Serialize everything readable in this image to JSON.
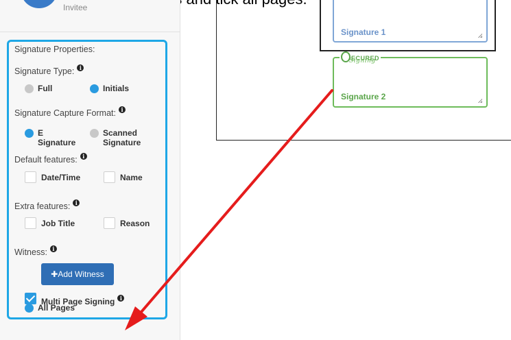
{
  "caption": "multipage signing all pages and tick all pages.",
  "sidebar": {
    "invitee_label": "Invitee",
    "panel": {
      "title": "Signature Properties:",
      "signature_type": {
        "label": "Signature Type:",
        "options": [
          {
            "label": "Full",
            "selected": false
          },
          {
            "label": "Initials",
            "selected": true
          }
        ]
      },
      "capture_format": {
        "label": "Signature Capture Format:",
        "options": [
          {
            "line1": "E",
            "line2": "Signature",
            "selected": true
          },
          {
            "line1": "Scanned",
            "line2": "Signature",
            "selected": false
          }
        ]
      },
      "default_features": {
        "label": "Default features:",
        "options": [
          {
            "label": "Date/Time",
            "checked": false
          },
          {
            "label": "Name",
            "checked": false
          }
        ]
      },
      "extra_features": {
        "label": "Extra features:",
        "options": [
          {
            "label": "Job Title",
            "checked": false
          },
          {
            "label": "Reason",
            "checked": false
          }
        ]
      },
      "witness": {
        "label": "Witness:",
        "button_label": "✚Add Witness"
      },
      "multi_page": {
        "label": "Multi Page Signing",
        "checked": true
      },
      "all_pages": {
        "label": "All Pages",
        "selected": true
      }
    }
  },
  "document": {
    "signature1_label": "Signature 1",
    "signature2_label": "Signature 2",
    "secured_logo_text": "ECURED",
    "secured_logo_script": "Signing"
  },
  "colors": {
    "panel_border": "#1ea7e6",
    "radio_on": "#2a9be0",
    "button_bg": "#2f6eb5",
    "sig1_border": "#7fa6d6",
    "sig2_border": "#6dbb5a",
    "arrow": "#e51c1c"
  }
}
